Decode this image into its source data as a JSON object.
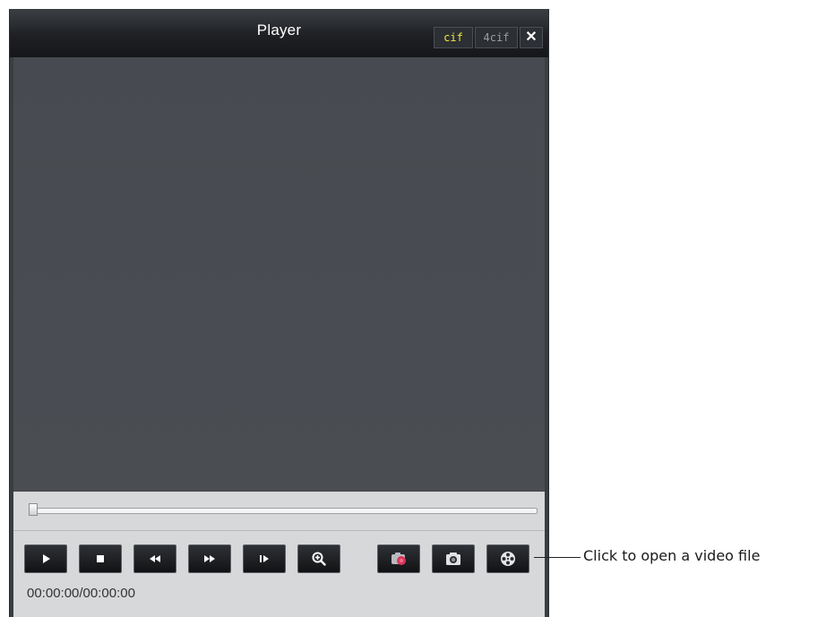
{
  "window": {
    "title": "Player",
    "mode_buttons": [
      {
        "label": "cif",
        "active": true
      },
      {
        "label": "4cif",
        "active": false
      }
    ],
    "close_label": "✕"
  },
  "playback": {
    "progress": 0,
    "time": "00:00:00/00:00:00"
  },
  "controls": [
    {
      "name": "play-button",
      "icon": "play-icon"
    },
    {
      "name": "stop-button",
      "icon": "stop-icon"
    },
    {
      "name": "rewind-button",
      "icon": "rewind-icon"
    },
    {
      "name": "fast-forward-button",
      "icon": "fast-forward-icon"
    },
    {
      "name": "step-frame-button",
      "icon": "step-forward-icon"
    },
    {
      "name": "zoom-button",
      "icon": "zoom-in-icon"
    },
    {
      "name": "record-button",
      "icon": "record-camera-icon"
    },
    {
      "name": "snapshot-button",
      "icon": "camera-icon"
    },
    {
      "name": "open-file-button",
      "icon": "film-reel-icon"
    }
  ],
  "annotation": {
    "text": "Click to open a video file"
  },
  "colors": {
    "titlebar": "#1e2024",
    "video_bg": "#474b51",
    "panel_bg": "#d7d8da",
    "cif_active": "#f2e63a",
    "record_red": "#d9345a"
  }
}
